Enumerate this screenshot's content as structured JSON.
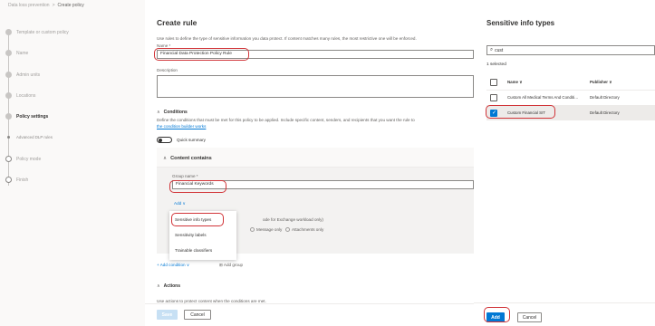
{
  "breadcrumb": {
    "parent": "Data loss prevention",
    "separator": ">",
    "current": "Create policy"
  },
  "wizard_steps": [
    {
      "label": "Template or custom policy",
      "state": "done"
    },
    {
      "label": "Name",
      "state": "done"
    },
    {
      "label": "Admin units",
      "state": "done"
    },
    {
      "label": "Locations",
      "state": "done"
    },
    {
      "label": "Policy settings",
      "state": "current"
    },
    {
      "label": "Advanced DLP rules",
      "state": "substep"
    },
    {
      "label": "Policy mode",
      "state": "todo"
    },
    {
      "label": "Finish",
      "state": "todo"
    }
  ],
  "form": {
    "title": "Create rule",
    "description": "Use rules to define the type of sensitive information you data protect. If content matches many rules, the most restrictive one will be enforced.",
    "name_label": "Name *",
    "name_value": "Financial Data Protection Policy Rule",
    "description_label": "Description",
    "description_value": "",
    "conditions": {
      "header": "Conditions",
      "text": "Define the conditions that must be met for this policy to be applied. Include specific content, senders, and recipients that you want the rule to",
      "link": "the condition builder works",
      "quick_summary": "Quick summary",
      "content_contains": "Content contains",
      "group_name_label": "Group name *",
      "group_name_value": "Financial Keywords",
      "add_label": "Add",
      "partial_text": "ode for Exchange workload only)",
      "radio_message": "Message only",
      "radio_attachments": "Attachments only",
      "add_condition": "Add condition",
      "add_group": "Add group"
    },
    "add_menu": [
      "Sensitive info types",
      "Sensitivity labels",
      "Trainable classifiers"
    ],
    "actions_header": "Actions",
    "actions_text": "Use actions to protect content when the conditions are met.",
    "save": "Save",
    "cancel": "Cancel"
  },
  "panel": {
    "title": "Sensitive info types",
    "search_value": "cust",
    "selected_count": "1 selected",
    "columns": {
      "name": "Name",
      "publisher": "Publisher"
    },
    "rows": [
      {
        "name": "Custom All Medical Terms And Conditio...",
        "publisher": "Default Directory",
        "checked": false
      },
      {
        "name": "Custom Financial SIT",
        "publisher": "Default Directory",
        "checked": true
      }
    ],
    "add": "Add",
    "cancel": "Cancel"
  },
  "colors": {
    "accent": "#0078d4",
    "highlight": "#d13438"
  }
}
